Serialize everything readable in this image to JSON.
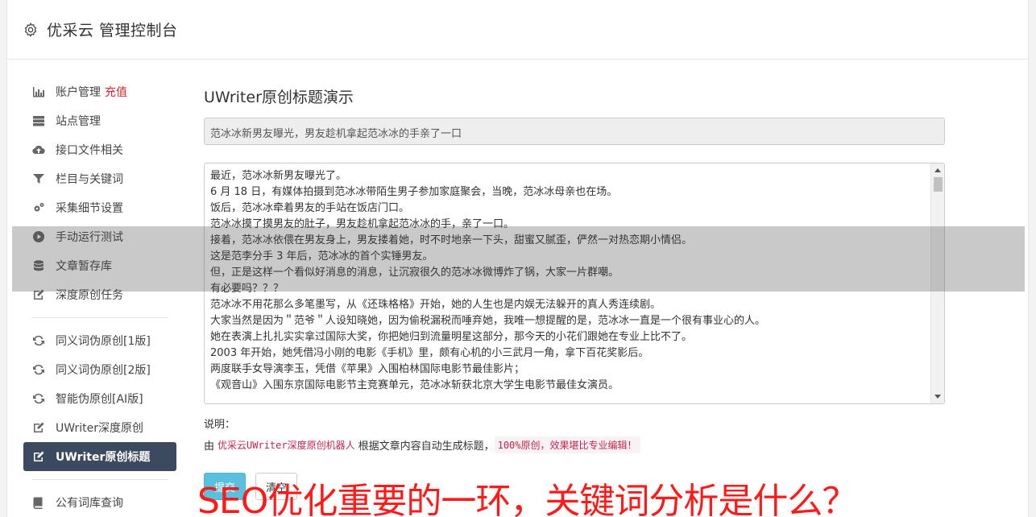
{
  "header": {
    "title": "优采云 管理控制台",
    "icon": "gear-icon"
  },
  "sidebar": {
    "groups": [
      [
        {
          "label": "账户管理",
          "tag": "充值",
          "icon": "bar-chart-icon"
        },
        {
          "label": "站点管理",
          "icon": "server-icon"
        },
        {
          "label": "接口文件相关",
          "icon": "cloud-upload-icon"
        },
        {
          "label": "栏目与关键词",
          "icon": "filter-icon"
        },
        {
          "label": "采集细节设置",
          "icon": "cogs-icon"
        },
        {
          "label": "手动运行测试",
          "icon": "play-circle-icon"
        },
        {
          "label": "文章暂存库",
          "icon": "database-icon"
        },
        {
          "label": "深度原创任务",
          "icon": "edit-icon"
        }
      ],
      [
        {
          "label": "同义词伪原创[1版]",
          "icon": "refresh-icon"
        },
        {
          "label": "同义词伪原创[2版]",
          "icon": "refresh-icon"
        },
        {
          "label": "智能伪原创[AI版]",
          "icon": "refresh-icon"
        },
        {
          "label": "UWriter深度原创",
          "icon": "edit-icon"
        },
        {
          "label": "UWriter原创标题",
          "icon": "edit-icon",
          "active": true
        }
      ],
      [
        {
          "label": "公有词库查询",
          "icon": "book-icon"
        }
      ]
    ]
  },
  "main": {
    "heading": "UWriter原创标题演示",
    "title_value": "范冰冰新男友曝光，男友趁机拿起范冰冰的手亲了一口",
    "content_lines": [
      "最近，范冰冰新男友曝光了。",
      "6 月 18 日，有媒体拍摄到范冰冰带陌生男子参加家庭聚会，当晚，范冰冰母亲也在场。",
      "饭后，范冰冰牵着男友的手站在饭店门口。",
      "范冰冰摸了摸男友的肚子，男友趁机拿起范冰冰的手，亲了一口。",
      "接着，范冰冰依偎在男友身上，男友搂着她，时不时地亲一下头，甜蜜又腻歪，俨然一对热恋期小情侣。",
      "这是范李分手 3 年后，范冰冰的首个实锤男友。",
      "但，正是这样一个看似好消息的消息，让沉寂很久的范冰冰微博炸了锅，大家一片群嘲。",
      "有必要吗？？？",
      "范冰冰不用花那么多笔墨写，从《还珠格格》开始，她的人生也是内娱无法躲开的真人秀连续剧。",
      "大家当然是因为＂范爷＂人设知晓她，因为偷税漏税而唾弃她，我唯一想提醒的是，范冰冰一直是一个很有事业心的人。",
      "她在表演上扎扎实实拿过国际大奖，你把她归到流量明星这部分，那今天的小花们跟她在专业上比不了。",
      "2003 年开始，她凭借冯小刚的电影《手机》里，颇有心机的小三武月一角，拿下百花奖影后。",
      "两度联手女导演李玉，凭借《苹果》入围柏林国际电影节最佳影片；",
      "《观音山》入围东京国际电影节主竞赛单元，范冰冰斩获北京大学生电影节最佳女演员。"
    ],
    "desc_label": "说明：",
    "desc_prefix": "由",
    "desc_link": "优采云UWriter深度原创机器人",
    "desc_middle": "根据文章内容自动生成标题，",
    "desc_badge": "100%原创，效果堪比专业编辑！",
    "submit_label": "提交",
    "clear_label": "清空"
  },
  "watermark": "SEO优化重要的一环，关键词分析是什么？"
}
